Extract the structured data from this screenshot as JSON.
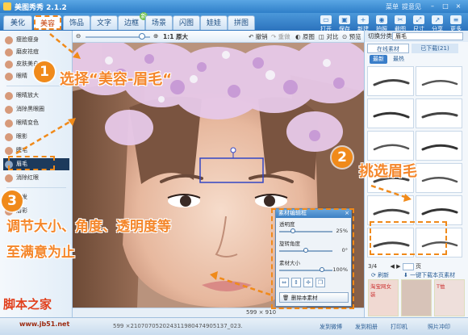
{
  "window": {
    "title": "美图秀秀 2.1.2",
    "links": [
      "菜单",
      "提意见"
    ],
    "controls": [
      "–",
      "□",
      "×"
    ]
  },
  "main_tabs": [
    {
      "label": "美化"
    },
    {
      "label": "美容"
    },
    {
      "label": "饰品"
    },
    {
      "label": "文字"
    },
    {
      "label": "边框",
      "badge": "新"
    },
    {
      "label": "场景"
    },
    {
      "label": "闪图"
    },
    {
      "label": "娃娃"
    },
    {
      "label": "拼图"
    }
  ],
  "top_tools": [
    "打开",
    "保存",
    "新建",
    "拍照",
    "截图",
    "尺寸",
    "分享",
    "更多"
  ],
  "left_tools": [
    {
      "label": "瘦脸瘦身"
    },
    {
      "label": "磨皮祛痘"
    },
    {
      "label": "皮肤美白"
    },
    {
      "label": "眼睛"
    },
    {
      "label": "眼睛放大"
    },
    {
      "label": "消除黑眼圈"
    },
    {
      "label": "眼睛变色"
    },
    {
      "label": "眼影"
    },
    {
      "label": "睫毛"
    },
    {
      "label": "眉毛"
    },
    {
      "label": "消除红眼"
    },
    {
      "label": "染发"
    },
    {
      "label": "唇彩"
    }
  ],
  "editor_toolbar": {
    "zoom_label": "1:1 原大",
    "undo": "撤销",
    "redo": "重做",
    "original": "原图",
    "compare": "对比",
    "preview": "预览"
  },
  "right_panel": {
    "category_label": "切换分类",
    "category_value": "眉毛",
    "tabs": [
      "在线素材",
      "已下载(21)"
    ],
    "subtabs": [
      "最新",
      "最热"
    ],
    "page_current": "3/4",
    "page_input": "",
    "page_go": "页",
    "refresh": "刷新",
    "download_page": "一键下载本页素材",
    "ads": [
      "淘宝网女装",
      "",
      "T恤"
    ]
  },
  "dialog": {
    "title": "素材编辑框",
    "opacity_label": "透明度",
    "opacity_value": "25%",
    "opacity_level": 0.25,
    "rotate_label": "旋转角度",
    "rotate_value": "0°",
    "rotate_level": 0.5,
    "size_label": "素材大小",
    "size_value": "100%",
    "size_level": 0.8,
    "delete": "删除本素材"
  },
  "callouts": {
    "step1_num": "1",
    "step1_text": "选择“美容-眉毛“",
    "step2_num": "2",
    "step2_text": "挑选眉毛",
    "step3_num": "3",
    "step3_text_line1": "调节大小、角度、透明度等",
    "step3_text_line2": "至满意为止"
  },
  "status": {
    "filename": "599 ×210707052024311980474905137_023.",
    "dimensions": "599 × 910",
    "bottom_items": [
      "发到微博",
      "发到相册",
      "打印机",
      "照片冲印"
    ]
  },
  "watermark": {
    "text": "脚本之家",
    "url": "www.jb51.net"
  },
  "colors": {
    "accent_orange": "#f08a1a",
    "title_blue": "#2f7fc9",
    "selected_item": "#1d3a5c"
  }
}
